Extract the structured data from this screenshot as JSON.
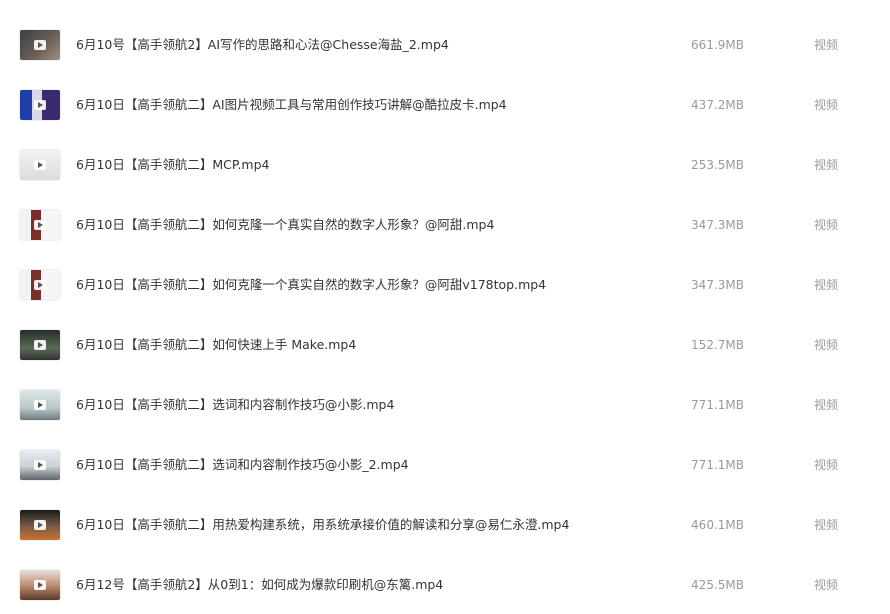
{
  "files": [
    {
      "name": "6月10号【高手领航2】AI写作的思路和心法@Chesse海盐_2.mp4",
      "size": "661.9MB",
      "type": "视频",
      "thumbnail_icon": "video-thumbnail-icon"
    },
    {
      "name": "6月10日【高手领航二】AI图片视频工具与常用创作技巧讲解@酷拉皮卡.mp4",
      "size": "437.2MB",
      "type": "视频",
      "thumbnail_icon": "video-thumbnail-icon"
    },
    {
      "name": "6月10日【高手领航二】MCP.mp4",
      "size": "253.5MB",
      "type": "视频",
      "thumbnail_icon": "video-thumbnail-icon"
    },
    {
      "name": "6月10日【高手领航二】如何克隆一个真实自然的数字人形象？@阿甜.mp4",
      "size": "347.3MB",
      "type": "视频",
      "thumbnail_icon": "video-thumbnail-icon"
    },
    {
      "name": "6月10日【高手领航二】如何克隆一个真实自然的数字人形象？@阿甜v178top.mp4",
      "size": "347.3MB",
      "type": "视频",
      "thumbnail_icon": "video-thumbnail-icon"
    },
    {
      "name": "6月10日【高手领航二】如何快速上手 Make.mp4",
      "size": "152.7MB",
      "type": "视频",
      "thumbnail_icon": "video-thumbnail-icon"
    },
    {
      "name": "6月10日【高手领航二】选词和内容制作技巧@小影.mp4",
      "size": "771.1MB",
      "type": "视频",
      "thumbnail_icon": "video-thumbnail-icon"
    },
    {
      "name": "6月10日【高手领航二】选词和内容制作技巧@小影_2.mp4",
      "size": "771.1MB",
      "type": "视频",
      "thumbnail_icon": "video-thumbnail-icon"
    },
    {
      "name": "6月10日【高手领航二】用热爱构建系统，用系统承接价值的解读和分享@易仁永澄.mp4",
      "size": "460.1MB",
      "type": "视频",
      "thumbnail_icon": "video-thumbnail-icon"
    },
    {
      "name": "6月12号【高手领航2】从0到1：如何成为爆款印刷机@东篱.mp4",
      "size": "425.5MB",
      "type": "视频",
      "thumbnail_icon": "video-thumbnail-icon"
    }
  ]
}
